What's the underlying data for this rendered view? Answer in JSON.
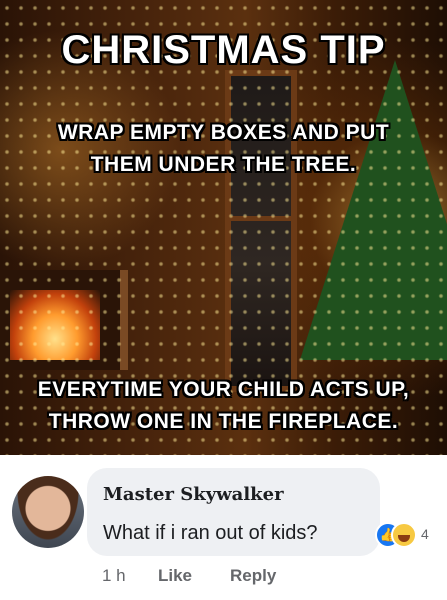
{
  "meme": {
    "title": "CHRISTMAS TIP",
    "line1": "WRAP EMPTY BOXES AND PUT",
    "line2": "THEM UNDER THE TREE.",
    "line3": "EVERYTIME YOUR CHILD ACTS UP,",
    "line4": "THROW ONE IN THE FIREPLACE."
  },
  "comment": {
    "author": "Master Skywalker",
    "text": "What if i ran out of kids?",
    "reaction_count": "4",
    "reaction_icons": [
      "like-icon",
      "haha-icon"
    ],
    "time": "1 h",
    "like_label": "Like",
    "reply_label": "Reply"
  },
  "colors": {
    "link_gray": "#65676b",
    "bubble_bg": "#eef0f3",
    "like_blue": "#1877f2"
  }
}
